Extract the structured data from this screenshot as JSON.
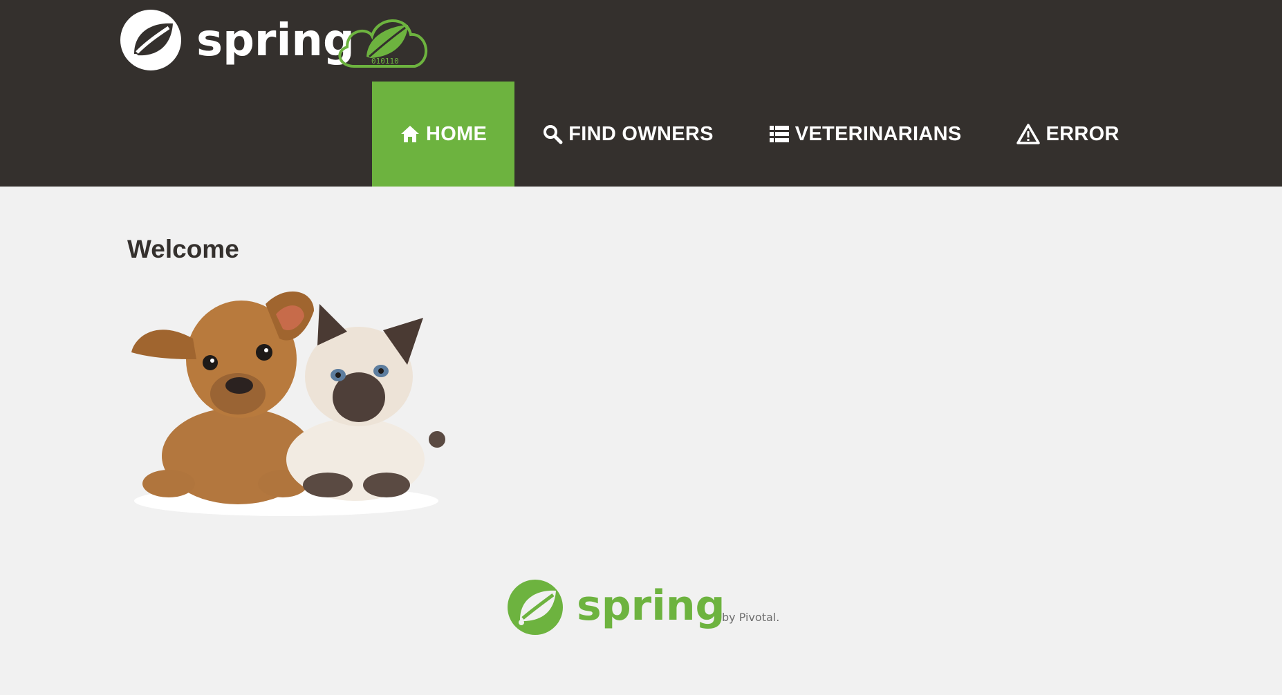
{
  "header": {
    "logo_text": "spring",
    "cloud_binary": "010110"
  },
  "nav": {
    "items": [
      {
        "label": "HOME",
        "icon": "home-icon",
        "active": true
      },
      {
        "label": "FIND OWNERS",
        "icon": "search-icon",
        "active": false
      },
      {
        "label": "VETERINARIANS",
        "icon": "list-icon",
        "active": false
      },
      {
        "label": "ERROR",
        "icon": "warning-icon",
        "active": false
      }
    ]
  },
  "main": {
    "heading": "Welcome",
    "image": "pets-image"
  },
  "footer": {
    "logo_text": "spring",
    "byline": "by Pivotal."
  },
  "colors": {
    "navbar_bg": "#34302d",
    "accent_green": "#6db33f",
    "page_bg": "#f1f1f1",
    "text_dark": "#34302d"
  }
}
